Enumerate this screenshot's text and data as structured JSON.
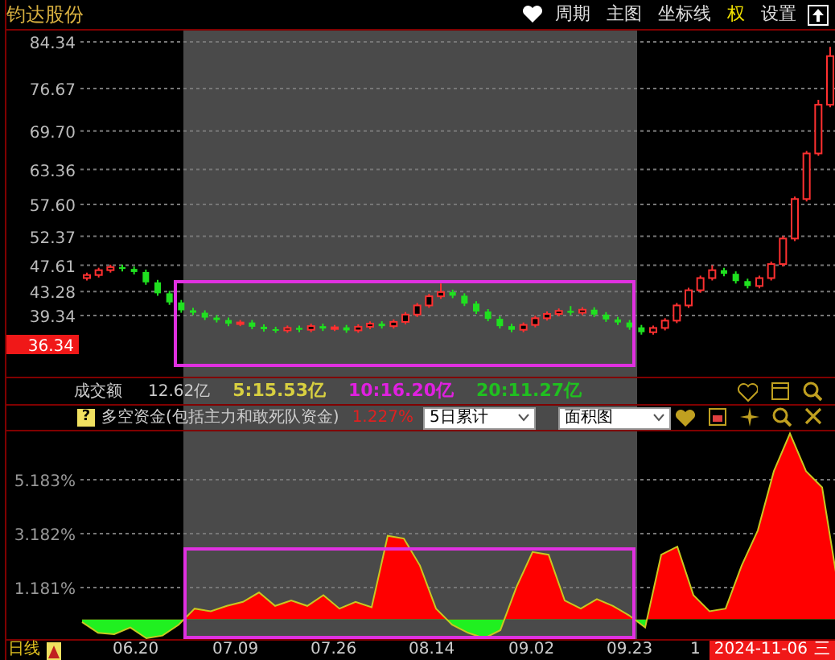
{
  "header": {
    "title": "钧达股份",
    "toolbar": [
      {
        "label": "周期",
        "on": false
      },
      {
        "label": "主图",
        "on": false
      },
      {
        "label": "坐标线",
        "on": false
      },
      {
        "label": "权",
        "on": true
      },
      {
        "label": "设置",
        "on": false
      }
    ]
  },
  "price_pane": {
    "current_price": "36.34",
    "chart_data": {
      "type": "candlestick",
      "grid": true,
      "ylim": [
        29.02,
        86.46
      ],
      "yticks": [
        {
          "value": 84.34,
          "label": "84.34"
        },
        {
          "value": 76.67,
          "label": "76.67"
        },
        {
          "value": 69.7,
          "label": "69.70"
        },
        {
          "value": 63.36,
          "label": "63.36"
        },
        {
          "value": 57.6,
          "label": "57.60"
        },
        {
          "value": 52.37,
          "label": "52.37"
        },
        {
          "value": 47.61,
          "label": "47.61"
        },
        {
          "value": 43.28,
          "label": "43.28"
        },
        {
          "value": 39.34,
          "label": "39.34"
        }
      ],
      "ohlc": [
        [
          45.5,
          46.4,
          45.1,
          46.0
        ],
        [
          46.0,
          47.2,
          45.6,
          46.8
        ],
        [
          46.8,
          47.7,
          46.4,
          47.3
        ],
        [
          47.3,
          47.7,
          46.6,
          47.0
        ],
        [
          47.0,
          47.4,
          46.1,
          46.5
        ],
        [
          46.5,
          46.9,
          44.4,
          44.8
        ],
        [
          44.8,
          45.2,
          42.6,
          43.0
        ],
        [
          43.0,
          43.4,
          41.1,
          41.5
        ],
        [
          41.5,
          41.9,
          39.8,
          40.2
        ],
        [
          40.2,
          40.6,
          39.4,
          39.8
        ],
        [
          39.8,
          40.2,
          38.6,
          39.0
        ],
        [
          39.0,
          39.4,
          38.2,
          38.6
        ],
        [
          38.6,
          39.0,
          37.6,
          38.0
        ],
        [
          38.0,
          38.6,
          37.6,
          38.2
        ],
        [
          38.2,
          38.6,
          37.1,
          37.5
        ],
        [
          37.5,
          37.9,
          36.7,
          37.1
        ],
        [
          37.1,
          37.5,
          36.5,
          36.9
        ],
        [
          36.9,
          37.7,
          36.5,
          37.3
        ],
        [
          37.3,
          37.7,
          36.6,
          37.0
        ],
        [
          37.0,
          38.0,
          36.6,
          37.6
        ],
        [
          37.6,
          38.0,
          36.8,
          37.2
        ],
        [
          37.2,
          37.8,
          36.8,
          37.4
        ],
        [
          37.4,
          37.8,
          36.5,
          36.9
        ],
        [
          36.9,
          37.9,
          36.5,
          37.5
        ],
        [
          37.5,
          38.4,
          37.1,
          38.0
        ],
        [
          38.0,
          38.4,
          37.2,
          37.6
        ],
        [
          37.6,
          38.7,
          37.2,
          38.3
        ],
        [
          38.3,
          39.9,
          37.9,
          39.5
        ],
        [
          39.5,
          41.4,
          39.1,
          41.0
        ],
        [
          41.0,
          42.9,
          40.6,
          42.5
        ],
        [
          42.5,
          44.6,
          42.1,
          43.2
        ],
        [
          43.2,
          43.6,
          42.2,
          42.6
        ],
        [
          42.6,
          43.0,
          40.9,
          41.3
        ],
        [
          41.3,
          41.7,
          39.6,
          40.0
        ],
        [
          40.0,
          40.4,
          38.4,
          38.8
        ],
        [
          38.8,
          39.2,
          37.2,
          37.6
        ],
        [
          37.6,
          38.0,
          36.6,
          37.0
        ],
        [
          37.0,
          38.2,
          36.6,
          37.8
        ],
        [
          37.8,
          39.3,
          37.4,
          38.9
        ],
        [
          38.9,
          40.0,
          38.5,
          39.6
        ],
        [
          39.6,
          40.5,
          39.2,
          40.1
        ],
        [
          40.1,
          40.9,
          39.4,
          39.8
        ],
        [
          39.8,
          40.7,
          39.4,
          40.3
        ],
        [
          40.3,
          40.7,
          39.1,
          39.5
        ],
        [
          39.5,
          39.9,
          38.3,
          38.7
        ],
        [
          38.7,
          39.1,
          37.8,
          38.2
        ],
        [
          38.2,
          38.6,
          37.0,
          37.4
        ],
        [
          37.4,
          37.8,
          36.2,
          36.6
        ],
        [
          36.6,
          37.7,
          36.2,
          37.3
        ],
        [
          37.3,
          38.9,
          36.9,
          38.5
        ],
        [
          38.5,
          41.4,
          38.1,
          41.0
        ],
        [
          41.0,
          43.9,
          40.6,
          43.5
        ],
        [
          43.5,
          45.9,
          43.1,
          45.5
        ],
        [
          45.5,
          47.6,
          45.1,
          46.8
        ],
        [
          46.8,
          47.2,
          45.8,
          46.2
        ],
        [
          46.2,
          46.6,
          44.6,
          45.0
        ],
        [
          45.0,
          45.4,
          43.8,
          44.2
        ],
        [
          44.2,
          45.9,
          43.8,
          45.5
        ],
        [
          45.5,
          48.2,
          45.1,
          47.8
        ],
        [
          47.8,
          52.4,
          47.4,
          52.0
        ],
        [
          52.0,
          58.9,
          51.6,
          58.5
        ],
        [
          58.5,
          66.4,
          58.1,
          66.0
        ],
        [
          66.0,
          74.8,
          65.6,
          74.0
        ],
        [
          74.0,
          83.5,
          73.6,
          82.0
        ]
      ]
    }
  },
  "volume_legend": {
    "name": "成交额",
    "value": "12.62亿",
    "averages": [
      {
        "label": "5:15.53亿",
        "color": "#d8d040"
      },
      {
        "label": "10:16.20亿",
        "color": "#e020e0"
      },
      {
        "label": "20:11.27亿",
        "color": "#20c020"
      }
    ]
  },
  "indicator": {
    "help": "?",
    "name": "多空资金(包括主力和敢死队资金)",
    "value": "1.227%",
    "period_select": "5日累计",
    "style_select": "面积图",
    "chart_data": {
      "type": "area",
      "grid": true,
      "ylim": [
        -0.79,
        7.035
      ],
      "yticks": [
        {
          "value": 5.183,
          "label": "5.183%"
        },
        {
          "value": 3.182,
          "label": "3.182%"
        },
        {
          "value": 1.181,
          "label": "1.181%"
        }
      ],
      "series": [
        {
          "color": "#ff0000",
          "values": [
            -0.1,
            -0.5,
            -0.55,
            -0.3,
            -0.7,
            -0.6,
            -0.2,
            0.4,
            0.3,
            0.5,
            0.65,
            1.0,
            0.5,
            0.7,
            0.5,
            0.9,
            0.4,
            0.65,
            0.45,
            3.1,
            3.0,
            2.0,
            0.4,
            -0.2,
            -0.5,
            -0.7,
            -0.4,
            1.2,
            2.5,
            2.4,
            0.7,
            0.4,
            0.75,
            0.5,
            0.15,
            -0.3,
            2.4,
            2.7,
            0.9,
            0.3,
            0.4,
            2.0,
            3.3,
            5.5,
            6.9,
            5.5,
            4.9,
            1.2
          ]
        }
      ]
    }
  },
  "date_axis": {
    "period": "日线",
    "dates": [
      "06.20",
      "07.09",
      "07.26",
      "08.14",
      "09.02",
      "09.23",
      "1"
    ],
    "current_date": "2024-11-06",
    "weekday": "三"
  }
}
